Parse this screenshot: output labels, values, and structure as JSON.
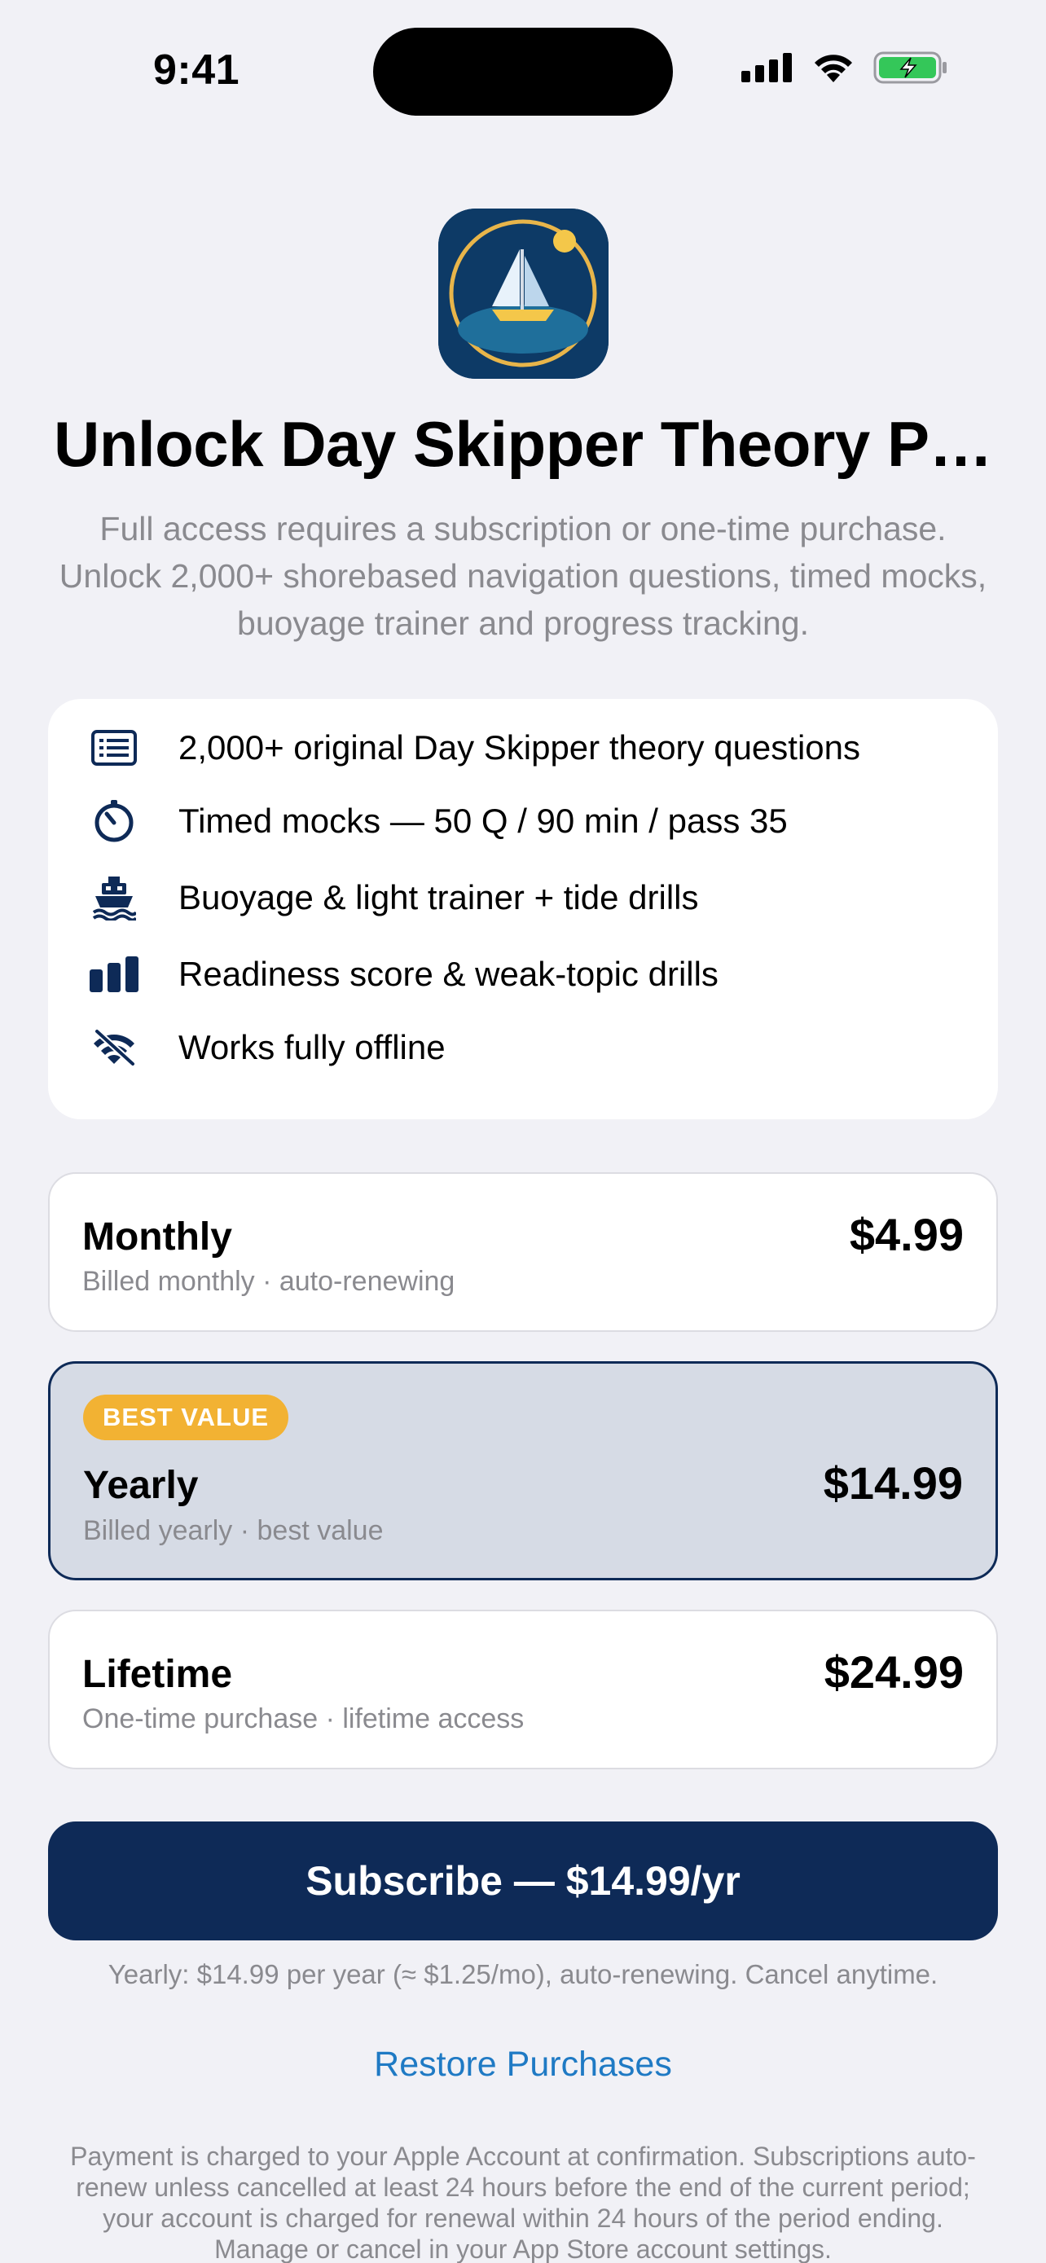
{
  "status_bar": {
    "time": "9:41",
    "icons": [
      "cellular-signal-icon",
      "wifi-icon",
      "battery-charging-icon"
    ]
  },
  "header": {
    "app_icon": "sailboat-app-icon",
    "title": "Unlock Day Skipper Theory P…",
    "subtitle": "Full access requires a subscription or one-time purchase. Unlock 2,000+ shorebased navigation questions, timed mocks, buoyage trainer and progress tracking."
  },
  "features": [
    {
      "icon": "list-icon",
      "label": "2,000+ original Day Skipper theory questions"
    },
    {
      "icon": "timer-icon",
      "label": "Timed mocks — 50 Q / 90 min / pass 35"
    },
    {
      "icon": "ferry-icon",
      "label": "Buoyage & light trainer + tide drills"
    },
    {
      "icon": "bar-chart-icon",
      "label": "Readiness score & weak-topic drills"
    },
    {
      "icon": "wifi-off-icon",
      "label": "Works fully offline"
    }
  ],
  "plans": [
    {
      "name": "Monthly",
      "description": "Billed monthly · auto-renewing",
      "price": "$4.99",
      "selected": false
    },
    {
      "name": "Yearly",
      "description": "Billed yearly · best value",
      "price": "$14.99",
      "badge": "BEST VALUE",
      "selected": true
    },
    {
      "name": "Lifetime",
      "description": "One-time purchase · lifetime access",
      "price": "$24.99",
      "selected": false
    }
  ],
  "cta": {
    "label": "Subscribe — $14.99/yr",
    "note": "Yearly: $14.99 per year (≈ $1.25/mo), auto-renewing. Cancel anytime."
  },
  "restore_label": "Restore Purchases",
  "legal": "Payment is charged to your Apple Account at confirmation. Subscriptions auto-renew unless cancelled at least 24 hours before the end of the current period; your account is charged for renewal within 24 hours of the period ending. Manage or cancel in your App Store account settings.",
  "colors": {
    "background": "#f1f1f6",
    "primary": "#0e2a57",
    "badge": "#f2b233",
    "link": "#1f7ac4",
    "secondary_text": "#8a8a8f"
  }
}
